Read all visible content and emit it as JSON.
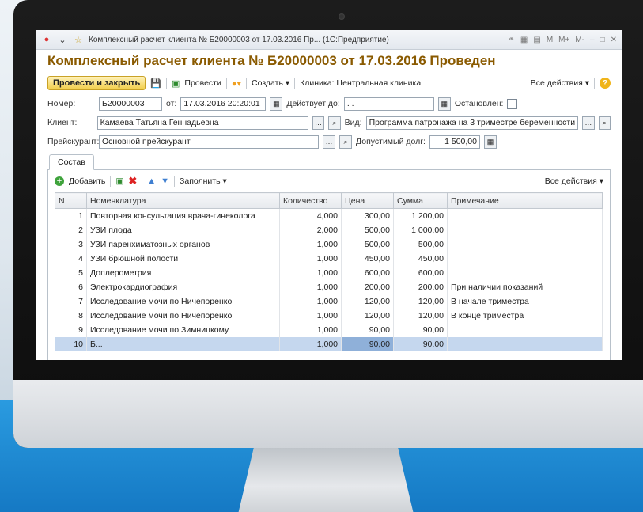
{
  "window": {
    "title": "Комплексный расчет клиента № Б20000003 от 17.03.2016 Пр... (1С:Предприятие)",
    "right_icons": [
      "M",
      "M+",
      "M-",
      "–",
      "□",
      "✕"
    ]
  },
  "doc_title": "Комплексный расчет клиента № Б20000003 от 17.03.2016 Проведен",
  "toolbar": {
    "post_close": "Провести и закрыть",
    "post": "Провести",
    "create": "Создать",
    "clinic": "Клиника: Центральная клиника",
    "all_actions": "Все действия"
  },
  "form": {
    "number_label": "Номер:",
    "number": "Б20000003",
    "from_label": "от:",
    "date": "17.03.2016 20:20:01",
    "valid_label": "Действует до:",
    "valid": " .  .",
    "stopped_label": "Остановлен:",
    "client_label": "Клиент:",
    "client": "Камаева Татьяна Геннадьевна",
    "kind_label": "Вид:",
    "kind": "Программа патронажа на 3 триместре беременности",
    "price_label": "Прейскурант:",
    "price": "Основной прейскурант",
    "debt_label": "Допустимый долг:",
    "debt": "1 500,00"
  },
  "tab": {
    "name": "Состав",
    "add": "Добавить",
    "fill": "Заполнить",
    "all_actions": "Все действия"
  },
  "table": {
    "headers": [
      "N",
      "Номенклатура",
      "Количество",
      "Цена",
      "Сумма",
      "Примечание"
    ],
    "rows": [
      [
        "1",
        "Повторная консультация врача-гинеколога",
        "4,000",
        "300,00",
        "1 200,00",
        ""
      ],
      [
        "2",
        "УЗИ плода",
        "2,000",
        "500,00",
        "1 000,00",
        ""
      ],
      [
        "3",
        "УЗИ паренхиматозных органов",
        "1,000",
        "500,00",
        "500,00",
        ""
      ],
      [
        "4",
        "УЗИ брюшной полости",
        "1,000",
        "450,00",
        "450,00",
        ""
      ],
      [
        "5",
        "Доплерометрия",
        "1,000",
        "600,00",
        "600,00",
        ""
      ],
      [
        "6",
        "Электрокардиография",
        "1,000",
        "200,00",
        "200,00",
        "При наличии показаний"
      ],
      [
        "7",
        "Исследование мочи по Ничепоренко",
        "1,000",
        "120,00",
        "120,00",
        "В начале триместра"
      ],
      [
        "8",
        "Исследование мочи по Ничепоренко",
        "1,000",
        "120,00",
        "120,00",
        "В конце триместра"
      ],
      [
        "9",
        "Исследование мочи по Зимницкому",
        "1,000",
        "90,00",
        "90,00",
        ""
      ],
      [
        "10",
        "Б...",
        "1,000",
        "90,00",
        "90,00",
        ""
      ]
    ]
  }
}
